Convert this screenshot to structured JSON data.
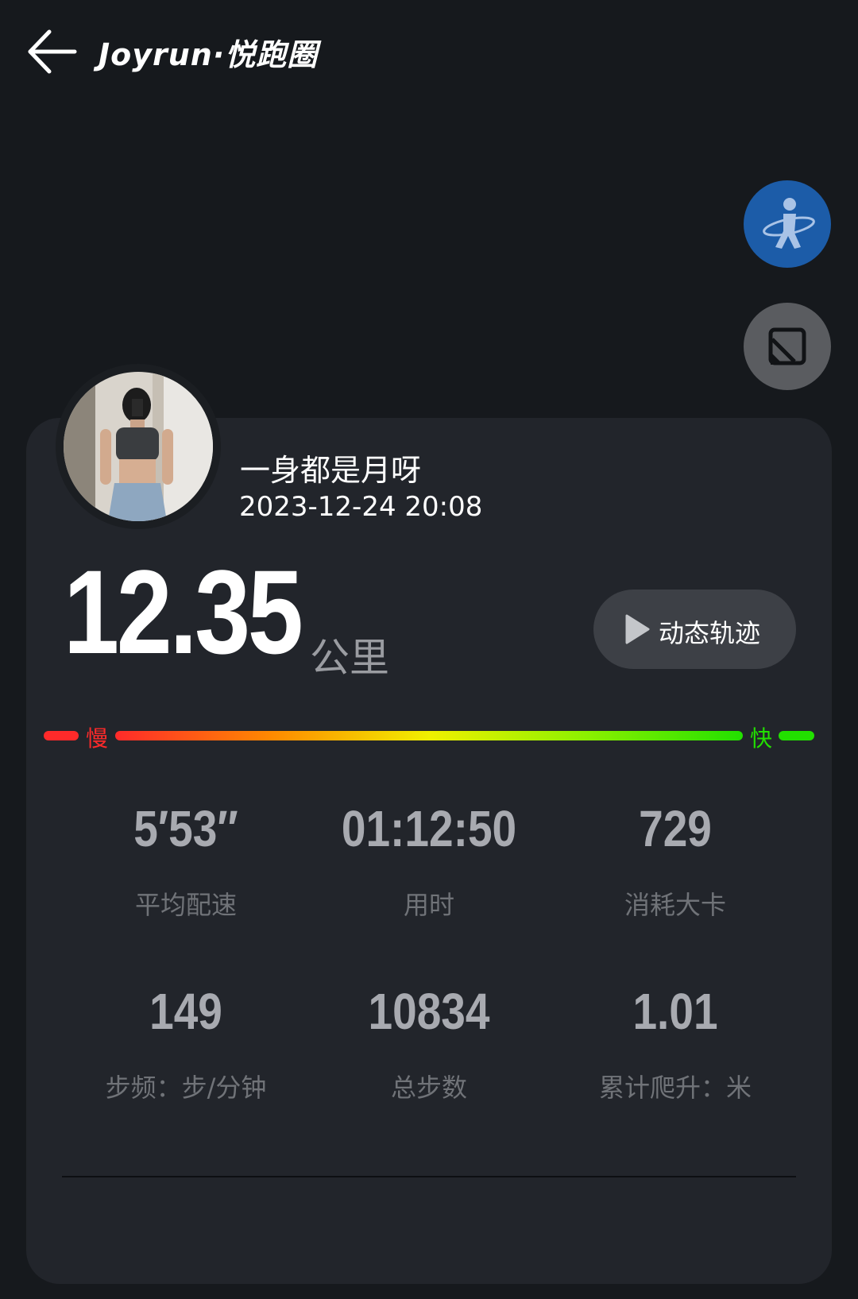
{
  "header": {
    "brand": "Joyrun·悦跑圈"
  },
  "icons": {
    "back": "arrow-left-icon",
    "runner": "runner-icon",
    "crop": "crop-icon",
    "play": "play-icon"
  },
  "profile": {
    "username": "一身都是月呀",
    "datetime": "2023-12-24 20:08"
  },
  "run": {
    "distance": "12.35",
    "unit": "公里",
    "track_button": "动态轨迹"
  },
  "pace_legend": {
    "slow": "慢",
    "fast": "快"
  },
  "stats": [
    {
      "value": "5′53′′",
      "label": "平均配速"
    },
    {
      "value": "01:12:50",
      "label": "用时"
    },
    {
      "value": "729",
      "label": "消耗大卡"
    },
    {
      "value": "149",
      "label": "步频：步/分钟"
    },
    {
      "value": "10834",
      "label": "总步数"
    },
    {
      "value": "1.01",
      "label": "累计爬升：米"
    }
  ],
  "colors": {
    "background": "#16191d",
    "card": "#22252b",
    "accent_blue": "#1c5ca8",
    "slow_red": "#ff2a2a",
    "fast_green": "#22e000",
    "stat_value": "#a8aab0",
    "stat_label": "#707378"
  }
}
